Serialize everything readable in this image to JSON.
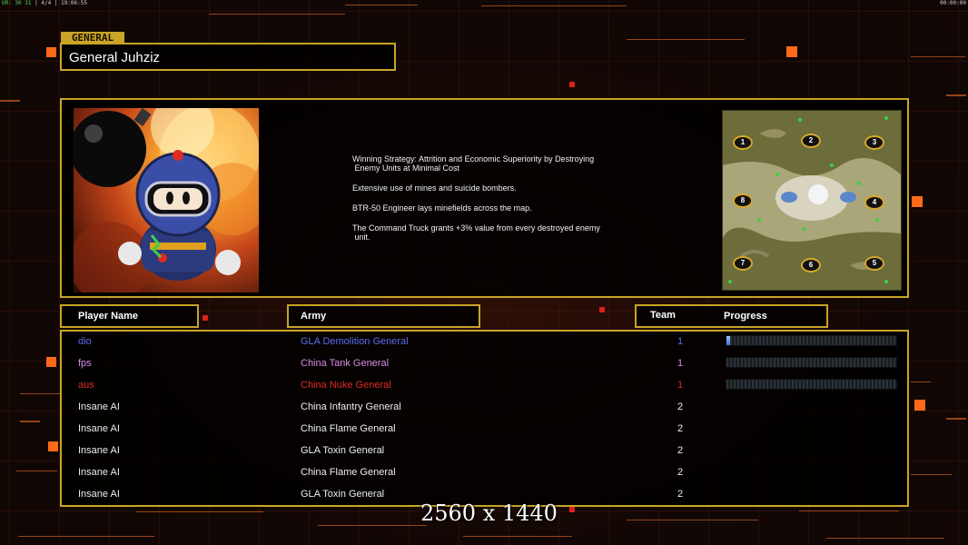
{
  "status_bar": {
    "left_green": "UR: 30 31",
    "left_gray": "| 4/4 |",
    "left_time": "19:06:55",
    "right_time": "00:00:00"
  },
  "general": {
    "tag": "GENERAL",
    "name": "General Juhziz",
    "portrait_icon": "bomberman-portrait",
    "strategy": [
      "Winning Strategy: Attrition and Economic Superiority by Destroying\n Enemy Units at Minimal Cost",
      "Extensive use of mines and suicide bombers.",
      "BTR-50 Engineer lays minefields across the map.",
      "The Command Truck grants +3% value from every destroyed enemy\n unit."
    ],
    "minimap_slots": [
      "1",
      "2",
      "3",
      "4",
      "5",
      "6",
      "7",
      "8"
    ]
  },
  "headers": {
    "player_name": "Player Name",
    "army": "Army",
    "team": "Team",
    "progress": "Progress"
  },
  "players": [
    {
      "name": "dio",
      "army": "GLA Demolition General",
      "team": "1",
      "color": "#5b6cf0",
      "progress": 0.02
    },
    {
      "name": "fps",
      "army": "China Tank General",
      "team": "1",
      "color": "#d98ae8",
      "progress": 0.0
    },
    {
      "name": "aus",
      "army": "China Nuke General",
      "team": "1",
      "color": "#e02a22",
      "progress": 0.0
    },
    {
      "name": "Insane AI",
      "army": "China Infantry General",
      "team": "2",
      "color": "#eeeeee"
    },
    {
      "name": "Insane AI",
      "army": "China Flame General",
      "team": "2",
      "color": "#eeeeee"
    },
    {
      "name": "Insane AI",
      "army": "GLA Toxin General",
      "team": "2",
      "color": "#eeeeee"
    },
    {
      "name": "Insane AI",
      "army": "China Flame General",
      "team": "2",
      "color": "#eeeeee"
    },
    {
      "name": "Insane AI",
      "army": "GLA Toxin General",
      "team": "2",
      "color": "#eeeeee"
    }
  ],
  "watermark": "2560 x 1440",
  "colors": {
    "accent": "#c9a426",
    "background": "#100705",
    "highlight": "#ff6a1a"
  }
}
